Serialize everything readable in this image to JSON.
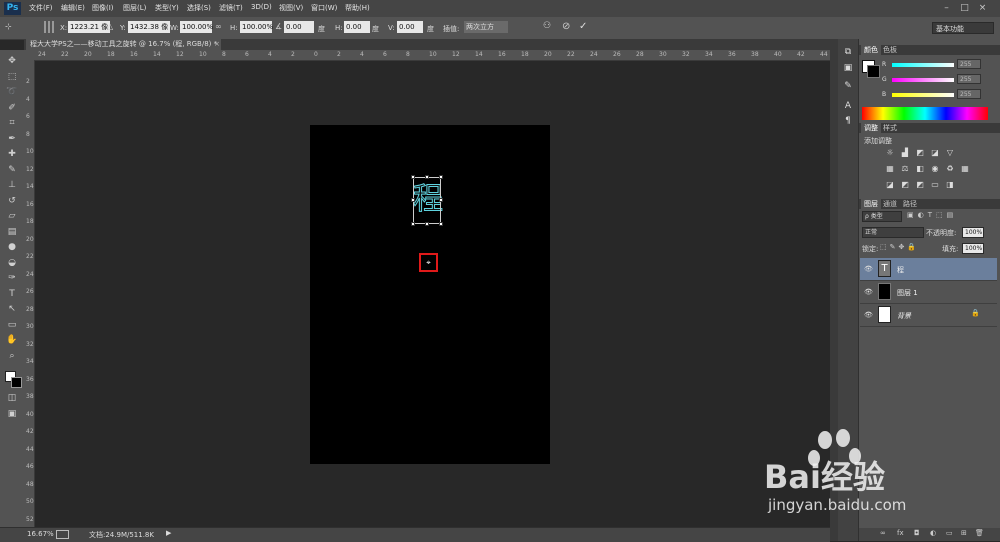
{
  "app": {
    "logo": "Ps"
  },
  "menu": [
    "文件(F)",
    "编辑(E)",
    "图像(I)",
    "图层(L)",
    "类型(Y)",
    "选择(S)",
    "滤镜(T)",
    "3D(D)",
    "视图(V)",
    "窗口(W)",
    "帮助(H)"
  ],
  "window_controls": [
    "–",
    "□",
    "×"
  ],
  "options": {
    "x_label": "X:",
    "x_value": "1223.21 像",
    "y_label": "Y:",
    "y_value": "1432.38 像",
    "w_label": "W:",
    "w_value": "100.00%",
    "h_label": "H:",
    "h_value": "100.00%",
    "angle_value": "0.00",
    "angle_unit": "度",
    "hskew_label": "H:",
    "hskew_value": "0.00",
    "hskew_unit": "度",
    "vskew_label": "V:",
    "vskew_value": "0.00",
    "vskew_unit": "度",
    "interp_label": "插值:",
    "interp_value": "两次立方",
    "workspace": "基本功能"
  },
  "document": {
    "tab_title": "程大大学PS之——移动工具之旋转 @ 16.7% (程, RGB/8) *",
    "tab_close": "×",
    "text_char": "程"
  },
  "ruler_h": [
    "24",
    "22",
    "20",
    "18",
    "16",
    "14",
    "12",
    "10",
    "8",
    "6",
    "4",
    "2",
    "0",
    "2",
    "4",
    "6",
    "8",
    "10",
    "12",
    "14",
    "16",
    "18",
    "20",
    "22",
    "24",
    "26",
    "28",
    "30",
    "32",
    "34",
    "36",
    "38",
    "40",
    "42",
    "44"
  ],
  "ruler_v": [
    "2",
    "4",
    "6",
    "8",
    "10",
    "12",
    "14",
    "16",
    "18",
    "20",
    "22",
    "24",
    "26",
    "28",
    "30",
    "32",
    "34",
    "36",
    "38",
    "40",
    "42",
    "44",
    "46",
    "48",
    "50",
    "52"
  ],
  "status": {
    "zoom": "16.67%",
    "doc_info": "文档:24.9M/511.8K"
  },
  "color_panel": {
    "tabs": [
      "颜色",
      "色板"
    ],
    "channels": [
      {
        "label": "R",
        "value": "255"
      },
      {
        "label": "G",
        "value": "255"
      },
      {
        "label": "B",
        "value": "255"
      }
    ]
  },
  "adjust_panel": {
    "tabs": [
      "调整",
      "样式"
    ],
    "title": "添加调整"
  },
  "layers_panel": {
    "tabs": [
      "图层",
      "通道",
      "路径"
    ],
    "filter_kind": "ρ 类型",
    "blend_mode": "正常",
    "opacity_label": "不透明度:",
    "opacity_value": "100%",
    "lock_label": "锁定:",
    "fill_label": "填充:",
    "fill_value": "100%",
    "layers": [
      {
        "name": "程",
        "type_glyph": "T",
        "selected": true
      },
      {
        "name": "图层 1",
        "selected": false
      },
      {
        "name": "背景",
        "selected": false
      }
    ]
  },
  "watermark": {
    "text": "Bai经验",
    "url": "jingyan.baidu.com"
  },
  "colors": {
    "accent_selected": "#6b7f9c",
    "text_stroke": "#5fd3df",
    "pivot_highlight": "#e01a1a"
  }
}
